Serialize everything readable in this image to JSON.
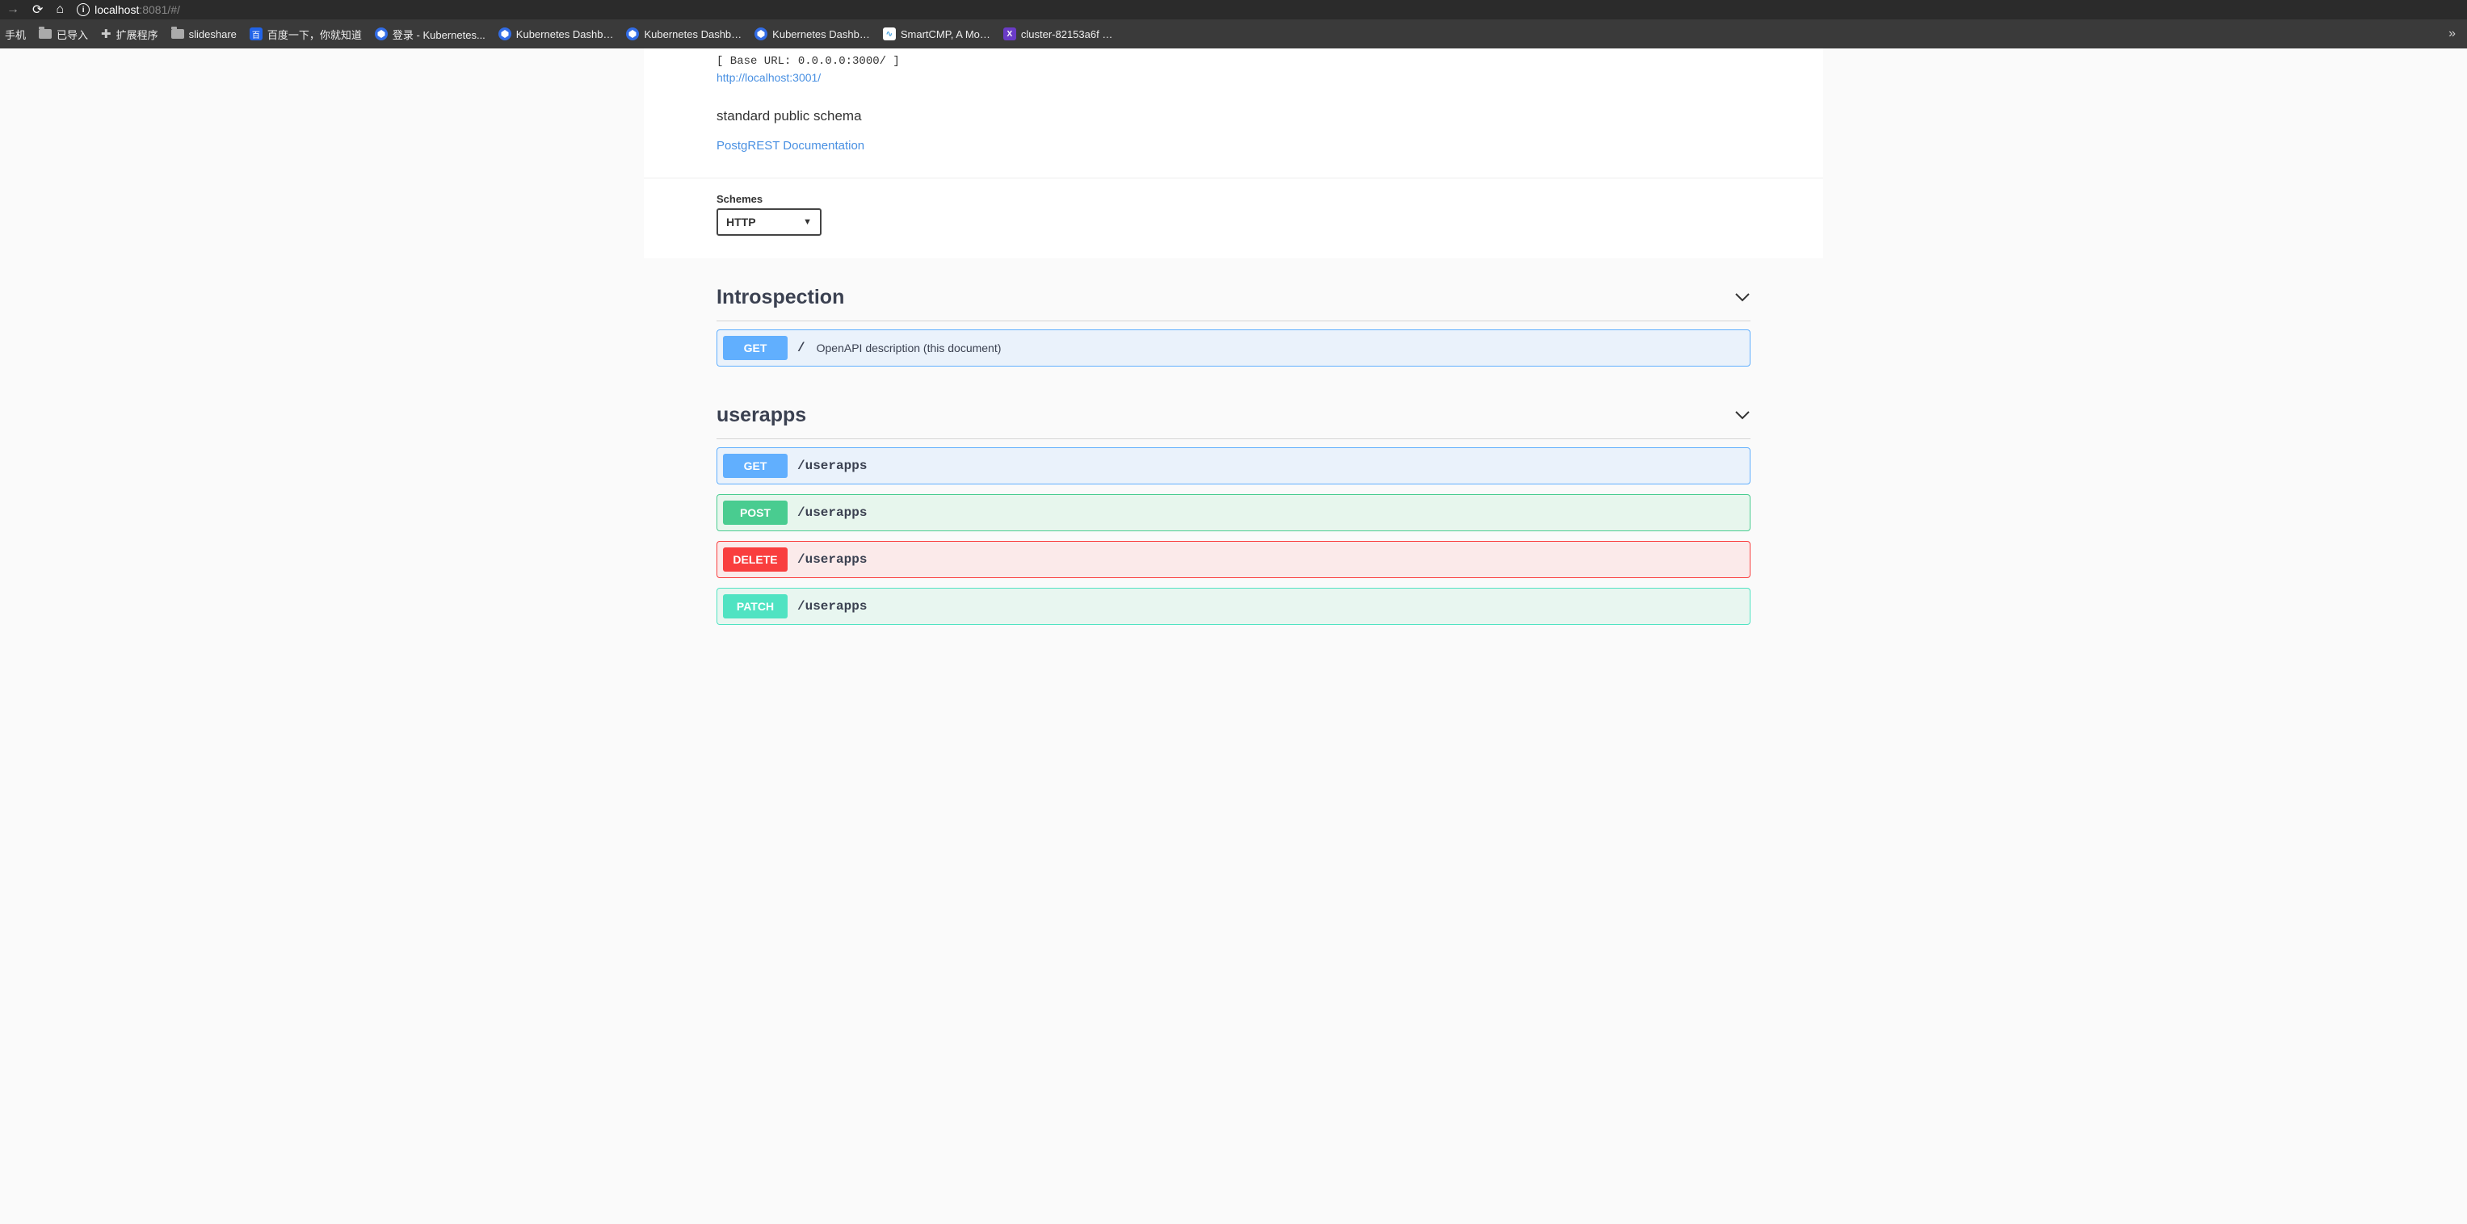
{
  "browser": {
    "url_host": "localhost",
    "url_rest": ":8081/#/"
  },
  "bookmarks": {
    "phone": "手机",
    "import": "已导入",
    "extensions": "扩展程序",
    "slideshare": "slideshare",
    "baidu": "百度一下，你就知道",
    "k8s_login": "登录 - Kubernetes...",
    "k8s_dash1": "Kubernetes Dashb…",
    "k8s_dash2": "Kubernetes Dashb…",
    "k8s_dash3": "Kubernetes Dashb…",
    "smartcmp": "SmartCMP, A Mo…",
    "cluster": "cluster-82153a6f …"
  },
  "info": {
    "base_url": "[ Base URL: 0.0.0.0:3000/ ]",
    "api_link": "http://localhost:3001/",
    "description": "standard public schema",
    "doc_link": "PostgREST Documentation"
  },
  "schemes": {
    "label": "Schemes",
    "selected": "HTTP"
  },
  "tags": [
    {
      "name": "Introspection",
      "ops": [
        {
          "method": "GET",
          "path": "/",
          "desc": "OpenAPI description (this document)",
          "cls": "op-get"
        }
      ]
    },
    {
      "name": "userapps",
      "ops": [
        {
          "method": "GET",
          "path": "/userapps",
          "desc": "",
          "cls": "op-get"
        },
        {
          "method": "POST",
          "path": "/userapps",
          "desc": "",
          "cls": "op-post"
        },
        {
          "method": "DELETE",
          "path": "/userapps",
          "desc": "",
          "cls": "op-delete"
        },
        {
          "method": "PATCH",
          "path": "/userapps",
          "desc": "",
          "cls": "op-patch"
        }
      ]
    }
  ]
}
